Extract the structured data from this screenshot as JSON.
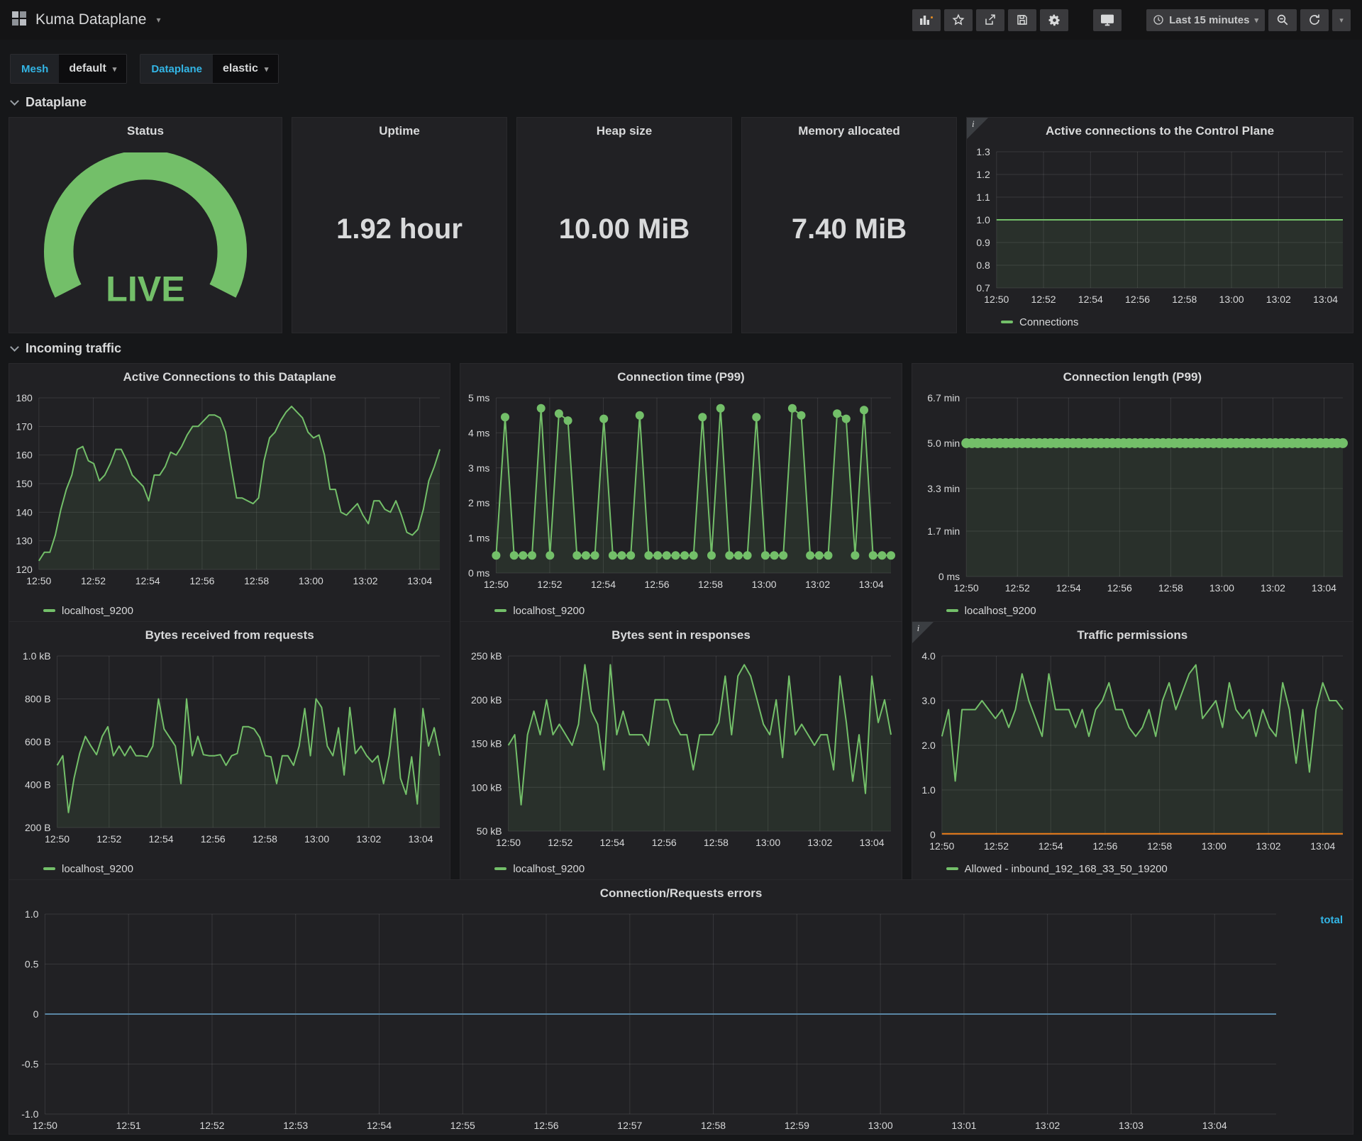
{
  "navbar": {
    "title": "Kuma Dataplane",
    "time_range": "Last 15 minutes",
    "icons": [
      "dashboards-grid",
      "add-panel",
      "star",
      "share",
      "save",
      "settings",
      "tv-cycle",
      "clock",
      "zoom-out",
      "refresh",
      "caret-down"
    ]
  },
  "filters": {
    "mesh": {
      "label": "Mesh",
      "value": "default"
    },
    "dataplane": {
      "label": "Dataplane",
      "value": "elastic"
    }
  },
  "sections": {
    "dataplane": "Dataplane",
    "incoming_traffic": "Incoming traffic"
  },
  "stats": {
    "status": {
      "title": "Status",
      "value": "LIVE",
      "color": "#73bf69"
    },
    "uptime": {
      "title": "Uptime",
      "value": "1.92 hour"
    },
    "heap": {
      "title": "Heap size",
      "value": "10.00 MiB"
    },
    "memory": {
      "title": "Memory allocated",
      "value": "7.40 MiB"
    }
  },
  "colors": {
    "green": "#73bf69",
    "orange": "#eb7b18",
    "blue_line": "#5a87a5",
    "link_blue": "#33b5e5"
  },
  "chart_data": [
    {
      "key": "active-connections-control-plane",
      "type": "line",
      "title": "Active connections to the Control Plane",
      "info_icon": true,
      "ylim": [
        0.7,
        1.3
      ],
      "yticks": [
        {
          "v": 1.3,
          "label": "1.3"
        },
        {
          "v": 1.2,
          "label": "1.2"
        },
        {
          "v": 1.1,
          "label": "1.1"
        },
        {
          "v": 1.0,
          "label": "1.0"
        },
        {
          "v": 0.9,
          "label": "0.9"
        },
        {
          "v": 0.8,
          "label": "0.8"
        },
        {
          "v": 0.7,
          "label": "0.7"
        }
      ],
      "xticks": [
        "12:50",
        "12:52",
        "12:54",
        "12:56",
        "12:58",
        "13:00",
        "13:02",
        "13:04"
      ],
      "series": [
        {
          "name": "Connections",
          "color": "#73bf69",
          "fill": true,
          "flat_value": 1.0,
          "count": 60
        }
      ],
      "legend_position": "bottom"
    },
    {
      "key": "active-connections-dataplane",
      "type": "line",
      "title": "Active Connections to this Dataplane",
      "info_icon": false,
      "ylim": [
        120,
        180
      ],
      "yticks": [
        {
          "v": 180,
          "label": "180"
        },
        {
          "v": 170,
          "label": "170"
        },
        {
          "v": 160,
          "label": "160"
        },
        {
          "v": 150,
          "label": "150"
        },
        {
          "v": 140,
          "label": "140"
        },
        {
          "v": 130,
          "label": "130"
        },
        {
          "v": 120,
          "label": "120"
        }
      ],
      "xticks": [
        "12:50",
        "12:52",
        "12:54",
        "12:56",
        "12:58",
        "13:00",
        "13:02",
        "13:04"
      ],
      "series": [
        {
          "name": "localhost_9200",
          "color": "#73bf69",
          "fill": true,
          "values": [
            123,
            126,
            126,
            132,
            141,
            148,
            153,
            162,
            163,
            158,
            157,
            151,
            153,
            157,
            162,
            162,
            158,
            153,
            151,
            149,
            144,
            153,
            153,
            156,
            161,
            160,
            163,
            167,
            170,
            170,
            172,
            174,
            174,
            173,
            168,
            156,
            145,
            145,
            144,
            143,
            145,
            158,
            166,
            168,
            172,
            175,
            177,
            175,
            173,
            168,
            166,
            167,
            160,
            148,
            148,
            140,
            139,
            141,
            143,
            139,
            136,
            144,
            144,
            141,
            140,
            144,
            139,
            133,
            132,
            134,
            141,
            151,
            156,
            162
          ]
        }
      ],
      "legend_position": "bottom"
    },
    {
      "key": "connection-time-p99",
      "type": "line",
      "title": "Connection time (P99)",
      "info_icon": false,
      "ylim": [
        0,
        5
      ],
      "yticks": [
        {
          "v": 5,
          "label": "5 ms"
        },
        {
          "v": 4,
          "label": "4 ms"
        },
        {
          "v": 3,
          "label": "3 ms"
        },
        {
          "v": 2,
          "label": "2 ms"
        },
        {
          "v": 1,
          "label": "1 ms"
        },
        {
          "v": 0,
          "label": "0 ms"
        }
      ],
      "xticks": [
        "12:50",
        "12:52",
        "12:54",
        "12:56",
        "12:58",
        "13:00",
        "13:02",
        "13:04"
      ],
      "series": [
        {
          "name": "localhost_9200",
          "color": "#73bf69",
          "fill": true,
          "markers": true,
          "marker_r": 6,
          "values": [
            0.5,
            4.45,
            0.5,
            0.5,
            0.5,
            4.7,
            0.5,
            4.55,
            4.35,
            0.5,
            0.5,
            0.5,
            4.4,
            0.5,
            0.5,
            0.5,
            4.5,
            0.5,
            0.5,
            0.5,
            0.5,
            0.5,
            0.5,
            4.45,
            0.5,
            4.7,
            0.5,
            0.5,
            0.5,
            4.45,
            0.5,
            0.5,
            0.5,
            4.7,
            4.5,
            0.5,
            0.5,
            0.5,
            4.55,
            4.4,
            0.5,
            4.65,
            0.5,
            0.5,
            0.5
          ]
        }
      ],
      "legend_position": "bottom"
    },
    {
      "key": "connection-length-p99",
      "type": "line",
      "title": "Connection length (P99)",
      "info_icon": false,
      "ylim": [
        0,
        6.7
      ],
      "yticks": [
        {
          "v": 6.7,
          "label": "6.7 min"
        },
        {
          "v": 5.0,
          "label": "5.0 min"
        },
        {
          "v": 3.3,
          "label": "3.3 min"
        },
        {
          "v": 1.7,
          "label": "1.7 min"
        },
        {
          "v": 0,
          "label": "0 ms"
        }
      ],
      "xticks": [
        "12:50",
        "12:52",
        "12:54",
        "12:56",
        "12:58",
        "13:00",
        "13:02",
        "13:04"
      ],
      "series": [
        {
          "name": "localhost_9200",
          "color": "#73bf69",
          "fill": true,
          "markers": true,
          "marker_r": 7,
          "flat_value": 5.0,
          "count": 68
        }
      ],
      "legend_position": "bottom"
    },
    {
      "key": "bytes-received",
      "type": "line",
      "title": "Bytes received from requests",
      "info_icon": false,
      "ylim": [
        200,
        1000
      ],
      "yticks": [
        {
          "v": 1000,
          "label": "1.0 kB"
        },
        {
          "v": 800,
          "label": "800 B"
        },
        {
          "v": 600,
          "label": "600 B"
        },
        {
          "v": 400,
          "label": "400 B"
        },
        {
          "v": 200,
          "label": "200 B"
        }
      ],
      "xticks": [
        "12:50",
        "12:52",
        "12:54",
        "12:56",
        "12:58",
        "13:00",
        "13:02",
        "13:04"
      ],
      "series": [
        {
          "name": "localhost_9200",
          "color": "#73bf69",
          "fill": true,
          "values": [
            490,
            535,
            270,
            430,
            545,
            625,
            580,
            540,
            625,
            670,
            535,
            580,
            535,
            580,
            535,
            535,
            530,
            580,
            800,
            660,
            620,
            580,
            405,
            800,
            535,
            625,
            540,
            535,
            535,
            540,
            490,
            535,
            545,
            670,
            670,
            660,
            620,
            535,
            530,
            405,
            535,
            535,
            490,
            580,
            755,
            535,
            800,
            760,
            580,
            535,
            665,
            445,
            760,
            545,
            580,
            535,
            505,
            535,
            405,
            535,
            755,
            430,
            355,
            530,
            310,
            755,
            580,
            665,
            535
          ]
        }
      ],
      "legend_position": "bottom"
    },
    {
      "key": "bytes-sent",
      "type": "line",
      "title": "Bytes sent in responses",
      "info_icon": false,
      "ylim": [
        50,
        250
      ],
      "yticks": [
        {
          "v": 250,
          "label": "250 kB"
        },
        {
          "v": 200,
          "label": "200 kB"
        },
        {
          "v": 150,
          "label": "150 kB"
        },
        {
          "v": 100,
          "label": "100 kB"
        },
        {
          "v": 50,
          "label": "50 kB"
        }
      ],
      "xticks": [
        "12:50",
        "12:52",
        "12:54",
        "12:56",
        "12:58",
        "13:00",
        "13:02",
        "13:04"
      ],
      "series": [
        {
          "name": "localhost_9200",
          "color": "#73bf69",
          "fill": true,
          "values": [
            148,
            160,
            80,
            160,
            187,
            160,
            200,
            160,
            172,
            160,
            148,
            172,
            240,
            187,
            172,
            120,
            240,
            160,
            187,
            160,
            160,
            160,
            148,
            200,
            200,
            200,
            174,
            160,
            160,
            120,
            160,
            160,
            160,
            174,
            227,
            160,
            227,
            240,
            227,
            200,
            172,
            160,
            200,
            134,
            227,
            160,
            172,
            160,
            148,
            160,
            160,
            120,
            227,
            174,
            107,
            160,
            93,
            227,
            174,
            200,
            160
          ]
        }
      ],
      "legend_position": "bottom"
    },
    {
      "key": "traffic-permissions",
      "type": "line",
      "title": "Traffic permissions",
      "info_icon": true,
      "ylim": [
        0,
        4
      ],
      "yticks": [
        {
          "v": 4,
          "label": "4.0"
        },
        {
          "v": 3,
          "label": "3.0"
        },
        {
          "v": 2,
          "label": "2.0"
        },
        {
          "v": 1,
          "label": "1.0"
        },
        {
          "v": 0,
          "label": "0"
        }
      ],
      "xticks": [
        "12:50",
        "12:52",
        "12:54",
        "12:56",
        "12:58",
        "13:00",
        "13:02",
        "13:04"
      ],
      "series": [
        {
          "name": "Allowed - inbound_192_168_33_50_19200",
          "color": "#73bf69",
          "fill": true,
          "values": [
            2.2,
            2.8,
            1.2,
            2.8,
            2.8,
            2.8,
            3.0,
            2.8,
            2.6,
            2.8,
            2.4,
            2.8,
            3.6,
            3.0,
            2.6,
            2.2,
            3.6,
            2.8,
            2.8,
            2.8,
            2.4,
            2.8,
            2.2,
            2.8,
            3.0,
            3.4,
            2.8,
            2.8,
            2.4,
            2.2,
            2.4,
            2.8,
            2.2,
            3.0,
            3.4,
            2.8,
            3.2,
            3.6,
            3.8,
            2.6,
            2.8,
            3.0,
            2.4,
            3.4,
            2.8,
            2.6,
            2.8,
            2.2,
            2.8,
            2.4,
            2.2,
            3.4,
            2.8,
            1.6,
            2.8,
            1.4,
            2.8,
            3.4,
            3.0,
            3.0,
            2.8
          ]
        },
        {
          "name": "",
          "color": "#eb7b18",
          "fill": false,
          "flat_value": 0.02,
          "count": 2
        }
      ],
      "legend_position": "bottom"
    },
    {
      "key": "connection-requests-errors",
      "type": "line",
      "title": "Connection/Requests errors",
      "info_icon": false,
      "ylim": [
        -1.0,
        1.0
      ],
      "yticks": [
        {
          "v": 1.0,
          "label": "1.0"
        },
        {
          "v": 0.5,
          "label": "0.5"
        },
        {
          "v": 0,
          "label": "0"
        },
        {
          "v": -0.5,
          "label": "-0.5"
        },
        {
          "v": -1.0,
          "label": "-1.0"
        }
      ],
      "xticks": [
        "12:50",
        "12:51",
        "12:52",
        "12:53",
        "12:54",
        "12:55",
        "12:56",
        "12:57",
        "12:58",
        "12:59",
        "13:00",
        "13:01",
        "13:02",
        "13:03",
        "13:04"
      ],
      "series": [
        {
          "name": "total",
          "color": "#5a87a5",
          "fill": false,
          "flat_value": 0,
          "count": 2
        }
      ],
      "legend_position": "right"
    }
  ]
}
